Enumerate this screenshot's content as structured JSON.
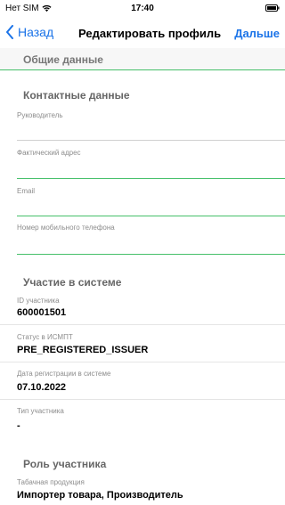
{
  "status_bar": {
    "carrier": "Нет SIM",
    "time": "17:40"
  },
  "nav": {
    "back_label": "Назад",
    "title": "Редактировать профиль",
    "next_label": "Дальше"
  },
  "general": {
    "title": "Общие данные"
  },
  "contacts": {
    "title": "Контактные данные",
    "manager_label": "Руководитель",
    "address_label": "Фактический адрес",
    "email_label": "Email",
    "phone_label": "Номер мобильного телефона"
  },
  "participation": {
    "title": "Участие в системе",
    "id_label": "ID участника",
    "id_value": "600001501",
    "status_label": "Статус в ИСМПТ",
    "status_value": "PRE_REGISTERED_ISSUER",
    "reg_date_label": "Дата регистрации в системе",
    "reg_date_value": "07.10.2022",
    "type_label": "Тип участника",
    "type_value": "-"
  },
  "role": {
    "title": "Роль участника",
    "tobacco_label": "Табачная продукция",
    "tobacco_value": "Импортер товара, Производитель"
  },
  "colors": {
    "accent": "#1a73e8",
    "underline_active": "#46c06a"
  }
}
